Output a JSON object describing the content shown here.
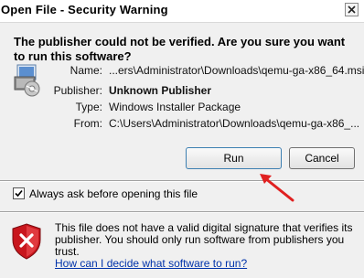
{
  "window": {
    "title": "Open File - Security Warning"
  },
  "question": "The publisher could not be verified.  Are you sure you want to run this software?",
  "details": [
    {
      "label": "Name:",
      "value": "...ers\\Administrator\\Downloads\\qemu-ga-x86_64.msi",
      "bold": false
    },
    {
      "label": "Publisher:",
      "value": "Unknown Publisher",
      "bold": true
    },
    {
      "label": "Type:",
      "value": "Windows Installer Package",
      "bold": false
    },
    {
      "label": "From:",
      "value": "C:\\Users\\Administrator\\Downloads\\qemu-ga-x86_...",
      "bold": false
    }
  ],
  "buttons": {
    "run": "Run",
    "cancel": "Cancel"
  },
  "checkbox": {
    "label": "Always ask before opening this file",
    "checked": true
  },
  "warning": {
    "text": "This file does not have a valid digital signature that verifies its publisher.  You should only run software from publishers you trust.",
    "link": "How can I decide what software to run?"
  },
  "icons": {
    "close": "close-icon",
    "file": "windows-installer-icon",
    "shield": "security-shield-icon",
    "arrow": "red-arrow-annotation"
  },
  "colors": {
    "link": "#0033aa",
    "shield_red": "#c8161d",
    "arrow_red": "#e02020"
  }
}
